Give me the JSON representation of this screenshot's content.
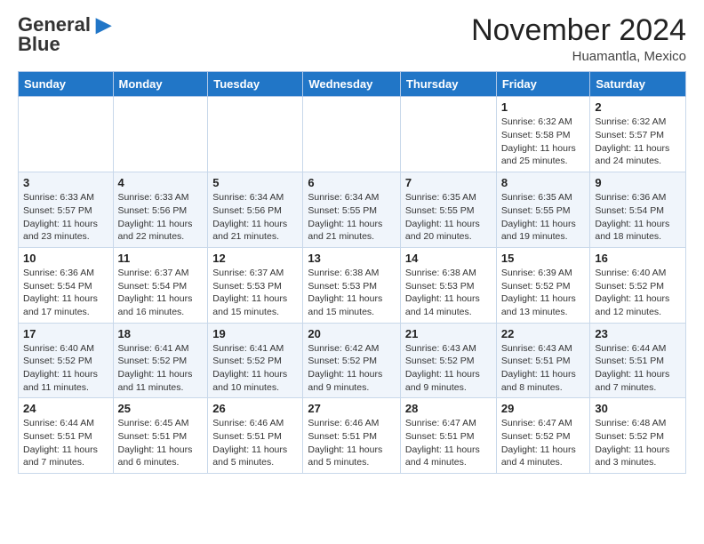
{
  "header": {
    "logo_line1": "General",
    "logo_line2": "Blue",
    "month_title": "November 2024",
    "subtitle": "Huamantla, Mexico"
  },
  "days_of_week": [
    "Sunday",
    "Monday",
    "Tuesday",
    "Wednesday",
    "Thursday",
    "Friday",
    "Saturday"
  ],
  "weeks": [
    [
      {
        "day": "",
        "info": ""
      },
      {
        "day": "",
        "info": ""
      },
      {
        "day": "",
        "info": ""
      },
      {
        "day": "",
        "info": ""
      },
      {
        "day": "",
        "info": ""
      },
      {
        "day": "1",
        "info": "Sunrise: 6:32 AM\nSunset: 5:58 PM\nDaylight: 11 hours\nand 25 minutes."
      },
      {
        "day": "2",
        "info": "Sunrise: 6:32 AM\nSunset: 5:57 PM\nDaylight: 11 hours\nand 24 minutes."
      }
    ],
    [
      {
        "day": "3",
        "info": "Sunrise: 6:33 AM\nSunset: 5:57 PM\nDaylight: 11 hours\nand 23 minutes."
      },
      {
        "day": "4",
        "info": "Sunrise: 6:33 AM\nSunset: 5:56 PM\nDaylight: 11 hours\nand 22 minutes."
      },
      {
        "day": "5",
        "info": "Sunrise: 6:34 AM\nSunset: 5:56 PM\nDaylight: 11 hours\nand 21 minutes."
      },
      {
        "day": "6",
        "info": "Sunrise: 6:34 AM\nSunset: 5:55 PM\nDaylight: 11 hours\nand 21 minutes."
      },
      {
        "day": "7",
        "info": "Sunrise: 6:35 AM\nSunset: 5:55 PM\nDaylight: 11 hours\nand 20 minutes."
      },
      {
        "day": "8",
        "info": "Sunrise: 6:35 AM\nSunset: 5:55 PM\nDaylight: 11 hours\nand 19 minutes."
      },
      {
        "day": "9",
        "info": "Sunrise: 6:36 AM\nSunset: 5:54 PM\nDaylight: 11 hours\nand 18 minutes."
      }
    ],
    [
      {
        "day": "10",
        "info": "Sunrise: 6:36 AM\nSunset: 5:54 PM\nDaylight: 11 hours\nand 17 minutes."
      },
      {
        "day": "11",
        "info": "Sunrise: 6:37 AM\nSunset: 5:54 PM\nDaylight: 11 hours\nand 16 minutes."
      },
      {
        "day": "12",
        "info": "Sunrise: 6:37 AM\nSunset: 5:53 PM\nDaylight: 11 hours\nand 15 minutes."
      },
      {
        "day": "13",
        "info": "Sunrise: 6:38 AM\nSunset: 5:53 PM\nDaylight: 11 hours\nand 15 minutes."
      },
      {
        "day": "14",
        "info": "Sunrise: 6:38 AM\nSunset: 5:53 PM\nDaylight: 11 hours\nand 14 minutes."
      },
      {
        "day": "15",
        "info": "Sunrise: 6:39 AM\nSunset: 5:52 PM\nDaylight: 11 hours\nand 13 minutes."
      },
      {
        "day": "16",
        "info": "Sunrise: 6:40 AM\nSunset: 5:52 PM\nDaylight: 11 hours\nand 12 minutes."
      }
    ],
    [
      {
        "day": "17",
        "info": "Sunrise: 6:40 AM\nSunset: 5:52 PM\nDaylight: 11 hours\nand 11 minutes."
      },
      {
        "day": "18",
        "info": "Sunrise: 6:41 AM\nSunset: 5:52 PM\nDaylight: 11 hours\nand 11 minutes."
      },
      {
        "day": "19",
        "info": "Sunrise: 6:41 AM\nSunset: 5:52 PM\nDaylight: 11 hours\nand 10 minutes."
      },
      {
        "day": "20",
        "info": "Sunrise: 6:42 AM\nSunset: 5:52 PM\nDaylight: 11 hours\nand 9 minutes."
      },
      {
        "day": "21",
        "info": "Sunrise: 6:43 AM\nSunset: 5:52 PM\nDaylight: 11 hours\nand 9 minutes."
      },
      {
        "day": "22",
        "info": "Sunrise: 6:43 AM\nSunset: 5:51 PM\nDaylight: 11 hours\nand 8 minutes."
      },
      {
        "day": "23",
        "info": "Sunrise: 6:44 AM\nSunset: 5:51 PM\nDaylight: 11 hours\nand 7 minutes."
      }
    ],
    [
      {
        "day": "24",
        "info": "Sunrise: 6:44 AM\nSunset: 5:51 PM\nDaylight: 11 hours\nand 7 minutes."
      },
      {
        "day": "25",
        "info": "Sunrise: 6:45 AM\nSunset: 5:51 PM\nDaylight: 11 hours\nand 6 minutes."
      },
      {
        "day": "26",
        "info": "Sunrise: 6:46 AM\nSunset: 5:51 PM\nDaylight: 11 hours\nand 5 minutes."
      },
      {
        "day": "27",
        "info": "Sunrise: 6:46 AM\nSunset: 5:51 PM\nDaylight: 11 hours\nand 5 minutes."
      },
      {
        "day": "28",
        "info": "Sunrise: 6:47 AM\nSunset: 5:51 PM\nDaylight: 11 hours\nand 4 minutes."
      },
      {
        "day": "29",
        "info": "Sunrise: 6:47 AM\nSunset: 5:52 PM\nDaylight: 11 hours\nand 4 minutes."
      },
      {
        "day": "30",
        "info": "Sunrise: 6:48 AM\nSunset: 5:52 PM\nDaylight: 11 hours\nand 3 minutes."
      }
    ]
  ]
}
